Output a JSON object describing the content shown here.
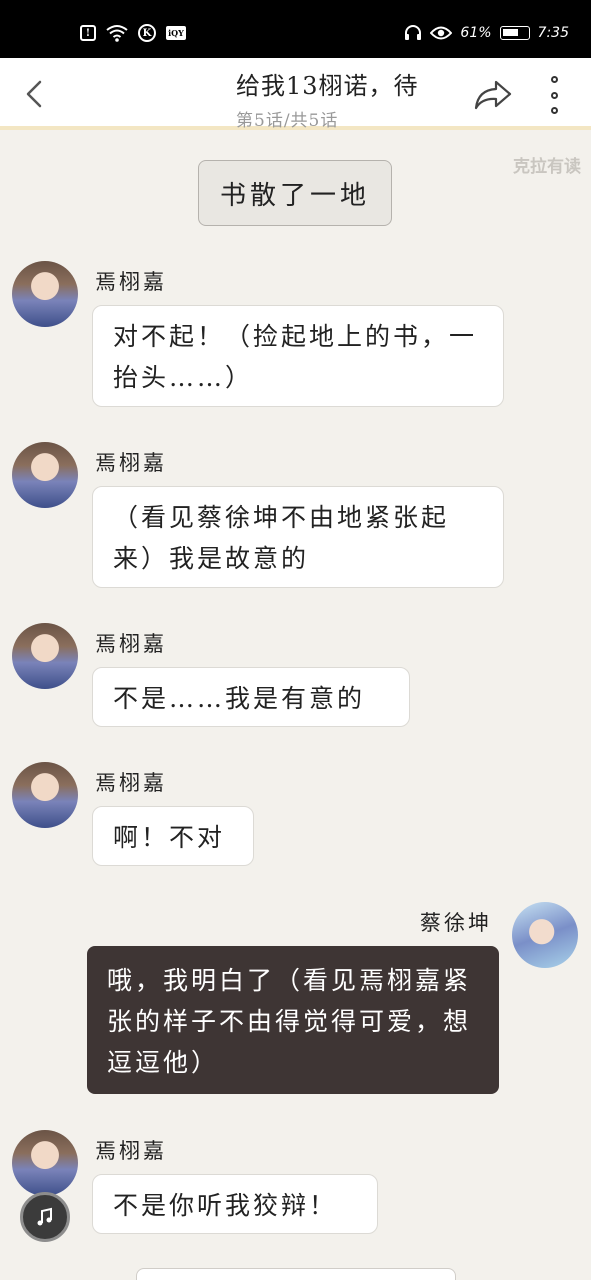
{
  "status_bar": {
    "left_icons": [
      "notification-icon",
      "wifi-icon",
      "k-app-icon",
      "iqiyi-icon"
    ],
    "battery_percent": "61%",
    "time": "7:35",
    "right_icons": [
      "headset-icon",
      "eye-icon",
      "battery-icon"
    ]
  },
  "header": {
    "title": "给我13栩诺，待",
    "subtitle": "第5话/共5话",
    "back_icon": "chevron-left-icon",
    "share_icon": "share-arrow-icon",
    "more_icon": "more-vertical-icon"
  },
  "watermark": "克拉有读",
  "narration": "书散了一地",
  "messages": [
    {
      "side": "left",
      "name": "焉栩嘉",
      "text": "对不起！（捡起地上的书，一抬头……）"
    },
    {
      "side": "left",
      "name": "焉栩嘉",
      "text": "（看见蔡徐坤不由地紧张起来）我是故意的"
    },
    {
      "side": "left",
      "name": "焉栩嘉",
      "text": "不是……我是有意的"
    },
    {
      "side": "left",
      "name": "焉栩嘉",
      "text": "啊！不对"
    },
    {
      "side": "right",
      "name": "蔡徐坤",
      "text": "哦，我明白了（看见焉栩嘉紧张的样子不由得觉得可爱，想逗逗他）"
    },
    {
      "side": "left",
      "name": "焉栩嘉",
      "text": "不是你听我狡辩！"
    }
  ],
  "floating_button_icon": "music-note-icon",
  "colors": {
    "background": "#f3f1ec",
    "header_accent": "#f3e6c3",
    "right_bubble": "#3e3534",
    "left_bubble": "#ffffff"
  }
}
